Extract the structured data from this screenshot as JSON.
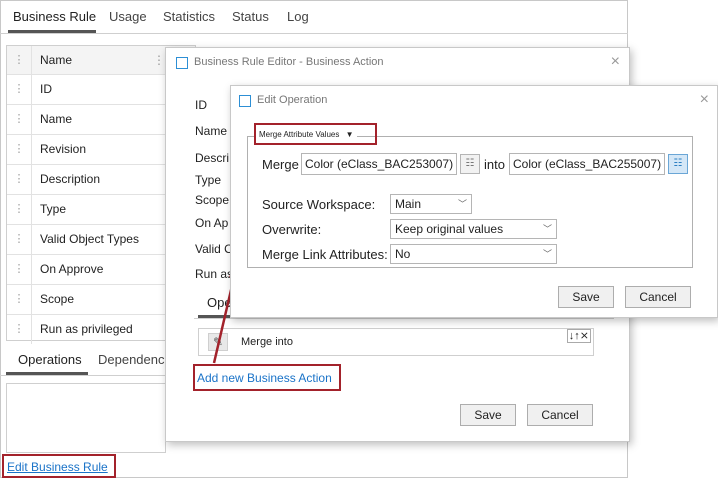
{
  "base": {
    "tabs": [
      {
        "label": "Business Rule",
        "active": true
      },
      {
        "label": "Usage"
      },
      {
        "label": "Statistics"
      },
      {
        "label": "Status"
      },
      {
        "label": "Log"
      }
    ],
    "grid_header": "Name",
    "grid_rows": [
      "ID",
      "Name",
      "Revision",
      "Description",
      "Type",
      "Valid Object Types",
      "On Approve",
      "Scope",
      "Run as privileged"
    ],
    "subtabs": [
      "Operations",
      "Dependencie"
    ],
    "edit_link": "Edit Business Rule"
  },
  "editor": {
    "title": "Business Rule Editor - Business Action",
    "field_labels": [
      "ID",
      "Name",
      "Descri",
      "Type",
      "Scope",
      "On Ap",
      "Valid O",
      "Run as"
    ],
    "ops_tab": "Ope",
    "action_text": "Merge  into",
    "action_controls": "↓↑⨯",
    "add_link": "Add new Business Action",
    "save": "Save",
    "cancel": "Cancel"
  },
  "operation": {
    "title": "Edit Operation",
    "type_dropdown": "Merge Attribute Values",
    "merge_label": "Merge",
    "into_label": "into",
    "source_attr": "Color (eClass_BAC253007)",
    "target_attr": "Color (eClass_BAC255007)",
    "source_workspace_label": "Source Workspace:",
    "source_workspace_value": "Main",
    "overwrite_label": "Overwrite:",
    "overwrite_value": "Keep original values",
    "merge_link_label": "Merge Link Attributes:",
    "merge_link_value": "No",
    "save": "Save",
    "cancel": "Cancel"
  },
  "colors": {
    "highlight": "#a3222b",
    "link": "#1a73c8",
    "window_icon": "#2d8fd5"
  }
}
